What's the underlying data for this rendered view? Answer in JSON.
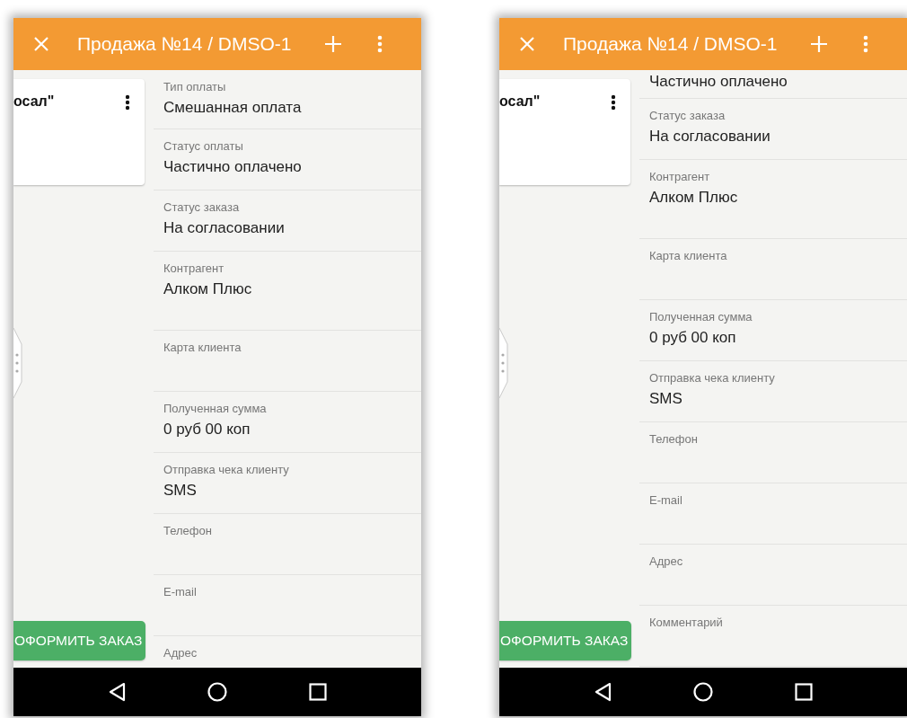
{
  "phones": [
    {
      "title": "Продажа №14 / DMSO-1",
      "card_text": "осал\"",
      "button": "ОФОРМИТЬ ЗАКАЗ",
      "fields": [
        {
          "kind": "first",
          "label": "Тип оплаты",
          "value": "Смешанная оплата"
        },
        {
          "kind": "normal",
          "label": "Статус оплаты",
          "value": "Частично оплачено"
        },
        {
          "kind": "normal",
          "label": "Статус заказа",
          "value": "На согласовании"
        },
        {
          "kind": "tall",
          "label": "Контрагент",
          "value": "Алком Плюс"
        },
        {
          "kind": "normal",
          "label": "Карта клиента"
        },
        {
          "kind": "normal",
          "label": "Полученная сумма",
          "value": "0 руб 00 коп"
        },
        {
          "kind": "normal",
          "label": "Отправка чека клиенту",
          "value": "SMS"
        },
        {
          "kind": "normal",
          "label": "Телефон"
        },
        {
          "kind": "normal",
          "label": "E-mail"
        },
        {
          "kind": "normal",
          "label": "Адрес"
        }
      ]
    },
    {
      "title": "Продажа №14 / DMSO-1",
      "card_text": "осал\"",
      "button": "ОФОРМИТЬ ЗАКАЗ",
      "fields": [
        {
          "kind": "cut",
          "value": "Частично оплачено"
        },
        {
          "kind": "normal",
          "label": "Статус заказа",
          "value": "На согласовании"
        },
        {
          "kind": "tall",
          "label": "Контрагент",
          "value": "Алком Плюс"
        },
        {
          "kind": "normal",
          "label": "Карта клиента"
        },
        {
          "kind": "normal",
          "label": "Полученная сумма",
          "value": "0 руб 00 коп"
        },
        {
          "kind": "normal",
          "label": "Отправка чека клиенту",
          "value": "SMS"
        },
        {
          "kind": "normal",
          "label": "Телефон"
        },
        {
          "kind": "normal",
          "label": "E-mail"
        },
        {
          "kind": "normal",
          "label": "Адрес"
        },
        {
          "kind": "normal",
          "label": "Комментарий"
        }
      ]
    }
  ]
}
